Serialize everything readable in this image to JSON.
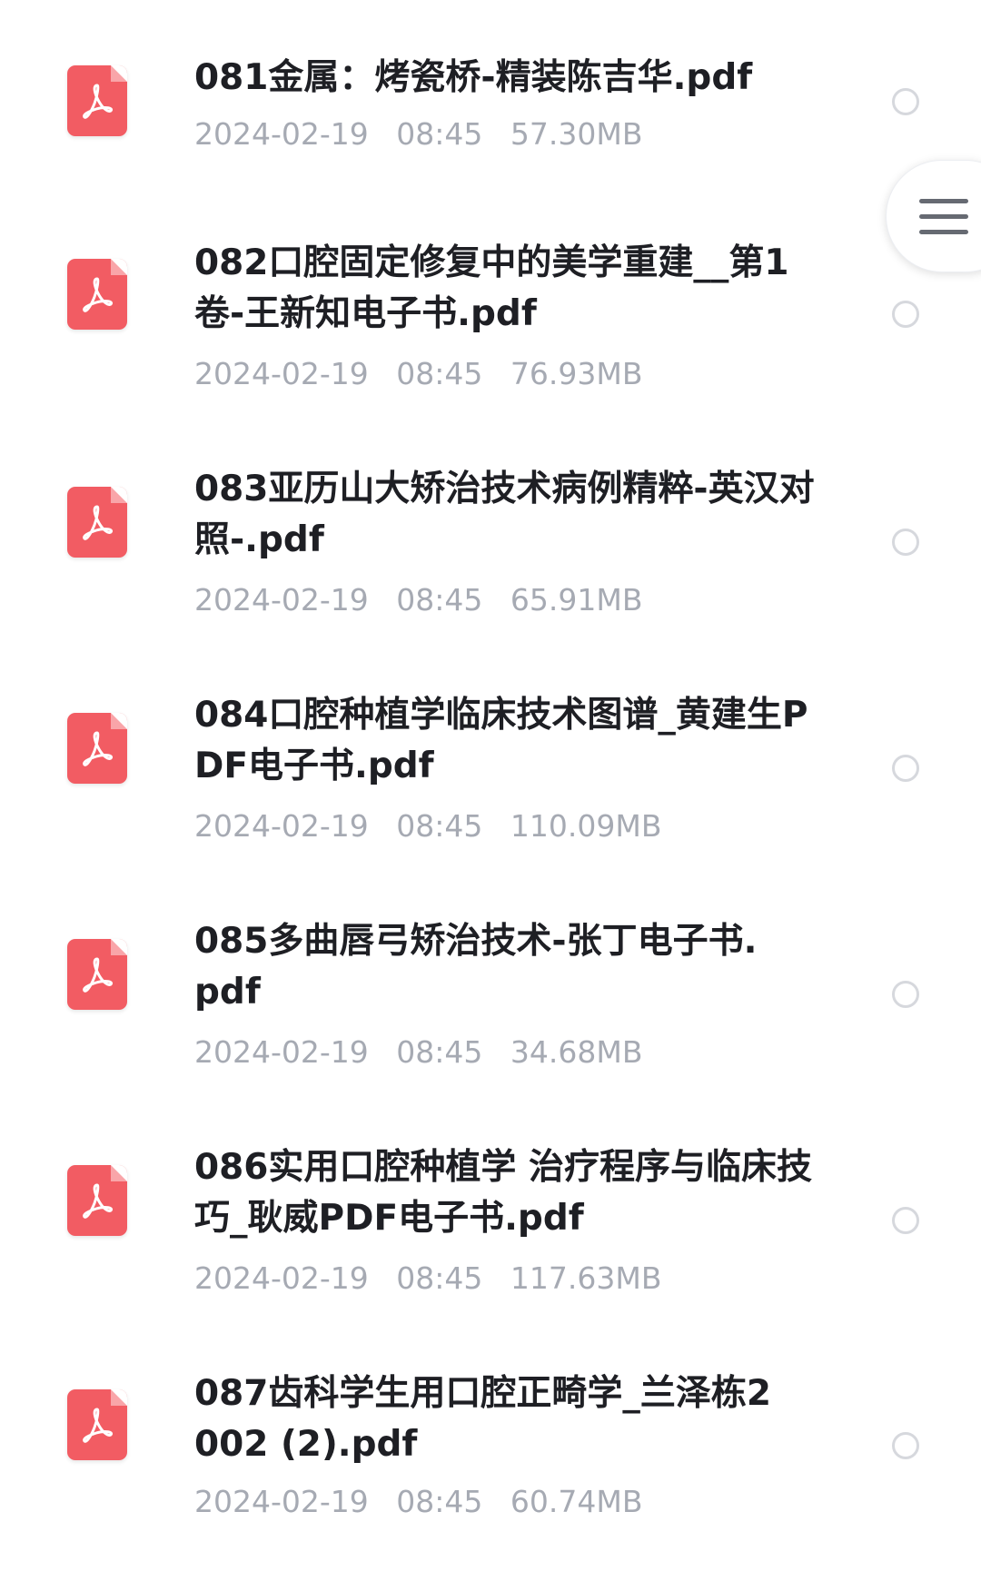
{
  "files": [
    {
      "name": "081金属：烤瓷桥-精装陈吉华.pdf",
      "date": "2024-02-19",
      "time": "08:45",
      "size": "57.30MB",
      "icon": "pdf-icon"
    },
    {
      "name": "082口腔固定修复中的美学重建__第1卷-王新知电子书.pdf",
      "date": "2024-02-19",
      "time": "08:45",
      "size": "76.93MB",
      "icon": "pdf-icon"
    },
    {
      "name": "083亚历山大矫治技术病例精粹-英汉对照-.pdf",
      "date": "2024-02-19",
      "time": "08:45",
      "size": "65.91MB",
      "icon": "pdf-icon"
    },
    {
      "name": "084口腔种植学临床技术图谱_黄建生PDF电子书.pdf",
      "date": "2024-02-19",
      "time": "08:45",
      "size": "110.09MB",
      "icon": "pdf-icon"
    },
    {
      "name": "085多曲唇弓矫治技术-张丁电子书.pdf",
      "date": "2024-02-19",
      "time": "08:45",
      "size": "34.68MB",
      "icon": "pdf-icon"
    },
    {
      "name": "086实用口腔种植学 治疗程序与临床技巧_耿威PDF电子书.pdf",
      "date": "2024-02-19",
      "time": "08:45",
      "size": "117.63MB",
      "icon": "pdf-icon"
    },
    {
      "name": "087齿科学生用口腔正畸学_兰泽栋2002 (2).pdf",
      "date": "2024-02-19",
      "time": "08:45",
      "size": "60.74MB",
      "icon": "pdf-icon"
    }
  ],
  "floating_menu": {
    "icon": "menu-icon"
  },
  "colors": {
    "pdf_red": "#f25c63",
    "title_text": "#1e1f24",
    "meta_text": "#a6aab3",
    "radio_border": "#d6d8dd"
  }
}
